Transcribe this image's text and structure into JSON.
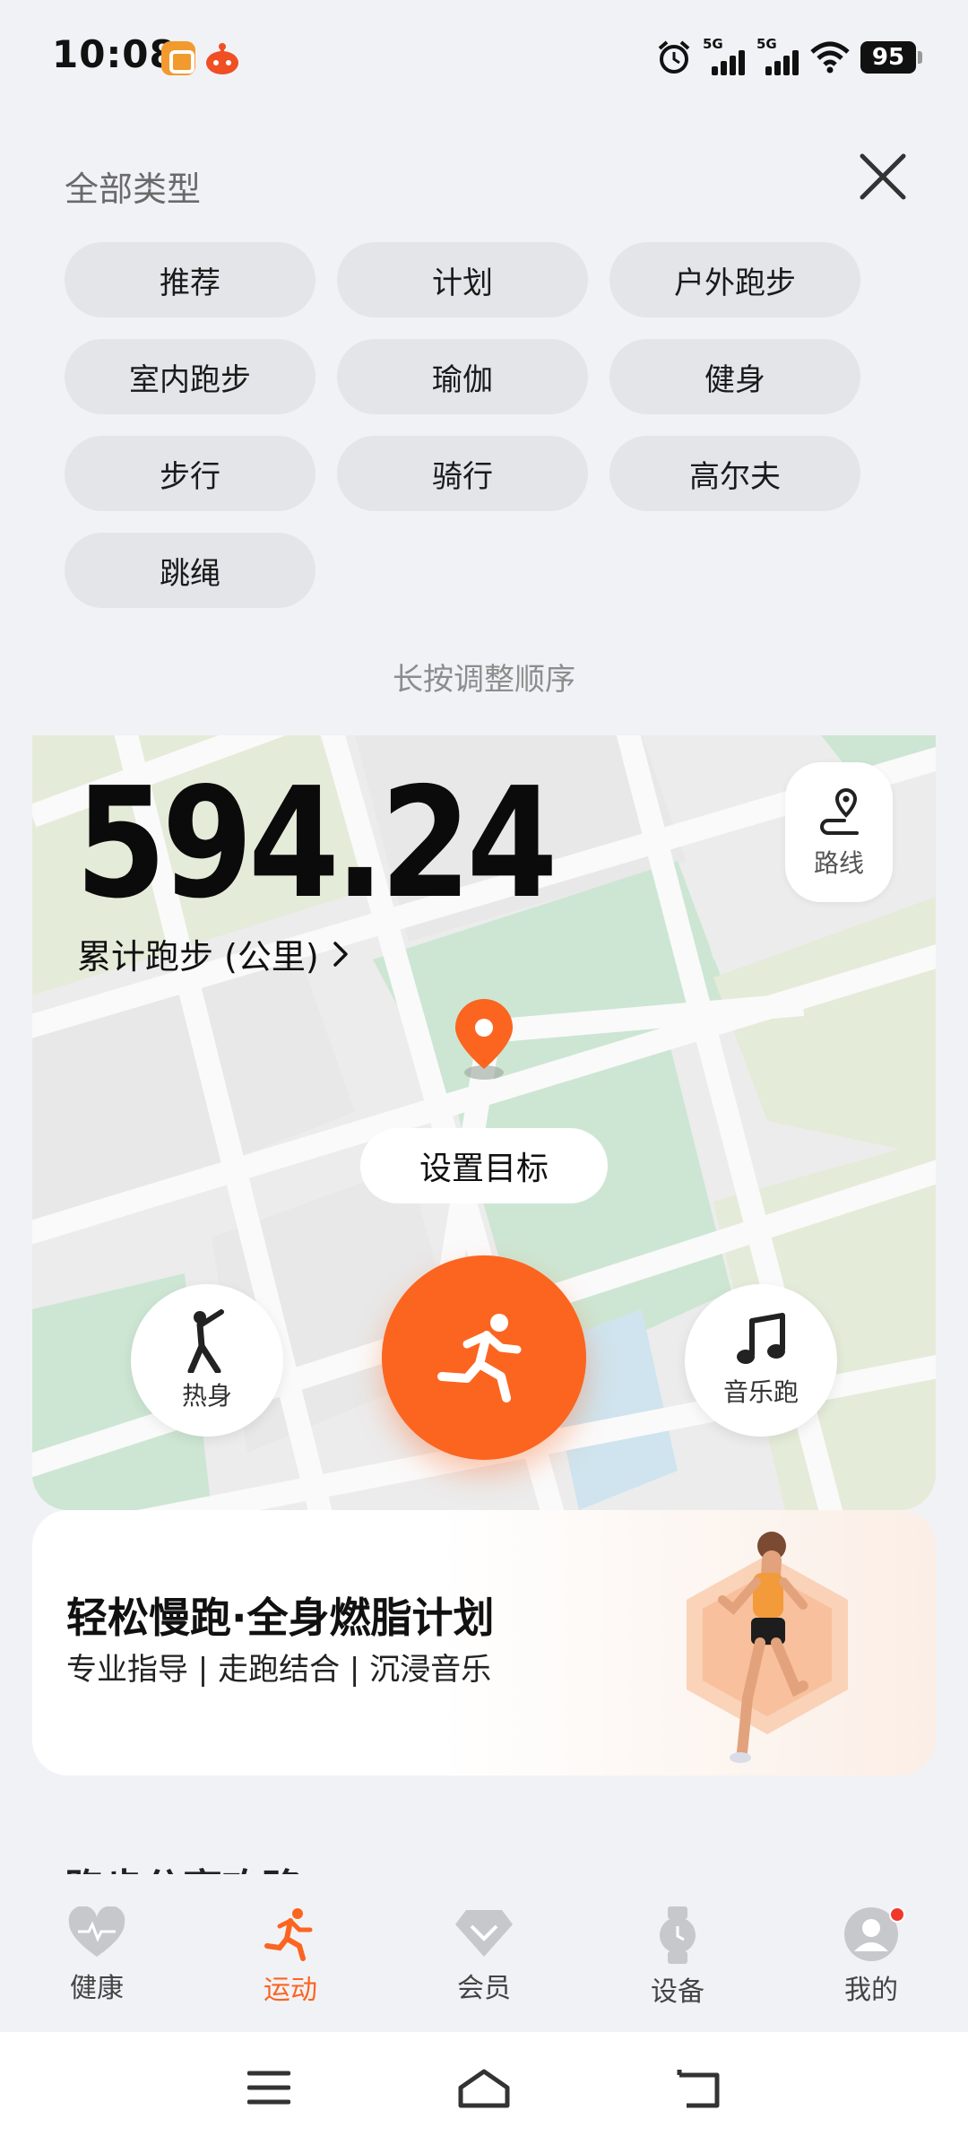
{
  "status_bar": {
    "time": "10:08",
    "signal_1": "5G",
    "signal_2": "5G",
    "battery": "95"
  },
  "category_panel": {
    "title": "全部类型",
    "chips": [
      "推荐",
      "计划",
      "户外跑步",
      "室内跑步",
      "瑜伽",
      "健身",
      "步行",
      "骑行",
      "高尔夫",
      "跳绳"
    ],
    "hint": "长按调整顺序"
  },
  "run_card": {
    "distance": "594.24",
    "distance_label": "累计跑步 (公里)",
    "route_label": "路线",
    "goal_label": "设置目标",
    "warmup_label": "热身",
    "music_label": "音乐跑",
    "accent_color": "#fb6520"
  },
  "promo": {
    "title": "轻松慢跑·全身燃脂计划",
    "subtitle": "专业指导 | 走跑结合 | 沉浸音乐"
  },
  "next_section": {
    "title": "跑步分享攻略"
  },
  "bottom_nav": {
    "items": [
      {
        "label": "健康",
        "icon": "heart-icon"
      },
      {
        "label": "运动",
        "icon": "runner-icon"
      },
      {
        "label": "会员",
        "icon": "diamond-icon"
      },
      {
        "label": "设备",
        "icon": "watch-icon"
      },
      {
        "label": "我的",
        "icon": "avatar-icon"
      }
    ],
    "active": "运动"
  },
  "system_nav": {
    "icons": [
      "menu-icon",
      "home-icon",
      "back-icon"
    ]
  }
}
